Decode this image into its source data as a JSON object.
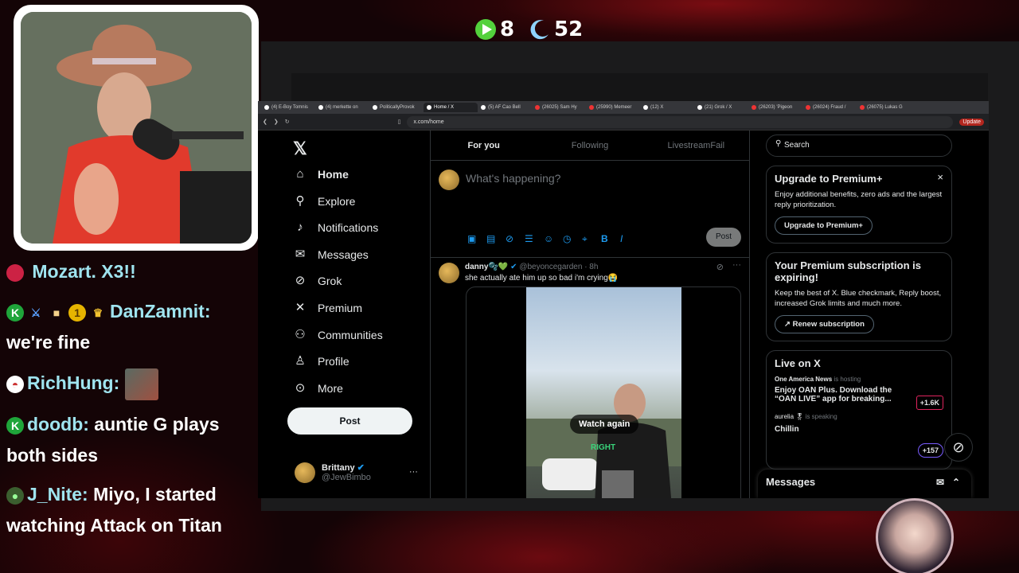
{
  "overlay": {
    "stat_play": "8",
    "stat_moon": "52",
    "accent": "#7a0d12"
  },
  "chat": [
    {
      "user": "Mozart. X3!!",
      "message": ""
    },
    {
      "user": "DanZamnit:",
      "message": "we're fine"
    },
    {
      "user": "RichHung:",
      "message": ""
    },
    {
      "user": "doodb:",
      "message": "auntie G plays both sides"
    },
    {
      "user": "J_Nite:",
      "message": "Miyo, I started watching Attack on Titan"
    }
  ],
  "browser": {
    "tabs": [
      "(4) E-Boy Tomnis",
      "(4) merkette on",
      "PoliticallyProvok",
      "Home / X",
      "(5) AF Cao Bell",
      "(26025) Sam Hy",
      "(25990) Memeer",
      "(12) X",
      "(21) Grok / X",
      "(26203) 'Pigeon",
      "(26024) Fraud /",
      "(26075) Lukas G"
    ],
    "active_tab": "Home / X",
    "url": "x.com/home",
    "update_label": "Update"
  },
  "x": {
    "nav": [
      {
        "label": "Home",
        "icon": "home-icon"
      },
      {
        "label": "Explore",
        "icon": "search-icon"
      },
      {
        "label": "Notifications",
        "icon": "bell-icon"
      },
      {
        "label": "Messages",
        "icon": "mail-icon"
      },
      {
        "label": "Grok",
        "icon": "grok-icon"
      },
      {
        "label": "Premium",
        "icon": "x-icon"
      },
      {
        "label": "Communities",
        "icon": "people-icon"
      },
      {
        "label": "Profile",
        "icon": "person-icon"
      },
      {
        "label": "More",
        "icon": "more-icon"
      }
    ],
    "post_label": "Post",
    "account": {
      "name": "Brittany",
      "handle": "@JewBimbo",
      "menu": "···"
    },
    "tabs": [
      "For you",
      "Following",
      "LivestreamFail"
    ],
    "compose_placeholder": "What's happening?",
    "compose_post": "Post",
    "tweet": {
      "name": "danny🫧💚",
      "handle": "@beyoncegarden · 8h",
      "text": "she actually ate him up so bad i'm crying😭",
      "watch_again": "Watch again",
      "caption": "RIGHT"
    },
    "search_placeholder": "Search",
    "premium_card": {
      "title": "Upgrade to Premium+",
      "body": "Enjoy additional benefits, zero ads and the largest reply prioritization.",
      "button": "Upgrade to Premium+",
      "close": "×"
    },
    "expiring_card": {
      "title": "Your Premium subscription is expiring!",
      "body": "Keep the best of X. Blue checkmark, Reply boost, increased Grok limits and much more.",
      "button": "Renew subscription"
    },
    "live": {
      "title": "Live on X",
      "items": [
        {
          "host": "One America News",
          "status": "is hosting",
          "title": "Enjoy OAN Plus. Download the “OAN LIVE” app for breaking...",
          "count": "+1.6K"
        },
        {
          "host": "aurelia 🎖",
          "status": "is speaking",
          "title": "Chillin",
          "count": "+157"
        }
      ]
    },
    "messages_title": "Messages"
  }
}
